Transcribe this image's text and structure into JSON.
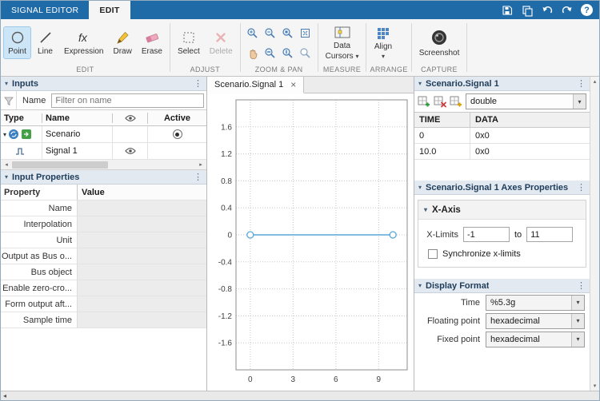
{
  "colors": {
    "accent_blue": "#1e6ba8",
    "signal_line": "#59a7d7",
    "selection": "#cde6f7"
  },
  "icons": {
    "dropdown_arrow": "▾",
    "menu_dots": "⋮",
    "collapse_arrow": "▾",
    "close": "×",
    "scroll_left": "◂",
    "scroll_right": "▸",
    "scroll_up": "▴",
    "scroll_down": "▾",
    "collapse_panel": "◂",
    "help": "?"
  },
  "topbar": {
    "tabs": [
      {
        "label": "SIGNAL EDITOR"
      },
      {
        "label": "EDIT"
      }
    ]
  },
  "ribbon": {
    "edit_section": "EDIT",
    "adjust_section": "ADJUST",
    "zoom_section": "ZOOM & PAN",
    "measure_section": "MEASURE",
    "arrange_section": "ARRANGE",
    "capture_section": "CAPTURE",
    "point": "Point",
    "line": "Line",
    "expression": "Expression",
    "draw": "Draw",
    "erase": "Erase",
    "select": "Select",
    "delete": "Delete",
    "data_cursors_line1": "Data",
    "data_cursors_line2": "Cursors",
    "align": "Align",
    "screenshot": "Screenshot"
  },
  "inputs_panel": {
    "title": "Inputs",
    "filter_label": "Name",
    "filter_placeholder": "Filter on name",
    "col_type": "Type",
    "col_name": "Name",
    "col_active": "Active",
    "rows": [
      {
        "name": "Scenario",
        "active": true,
        "visible": false
      },
      {
        "name": "Signal 1",
        "active": false,
        "visible": true
      }
    ]
  },
  "properties_panel": {
    "title": "Input Properties",
    "col_property": "Property",
    "col_value": "Value",
    "rows": [
      "Name",
      "Interpolation",
      "Unit",
      "Output as Bus o...",
      "Bus object",
      "Enable zero-cro...",
      "Form output aft...",
      "Sample time"
    ]
  },
  "canvas": {
    "tab_label": "Scenario.Signal 1"
  },
  "chart_data": {
    "type": "line",
    "title": "",
    "xlabel": "",
    "ylabel": "",
    "xlim": [
      -1,
      11
    ],
    "ylim": [
      -2,
      2
    ],
    "xticks": [
      0,
      3,
      6,
      9
    ],
    "yticks": [
      -1.6,
      -1.2,
      -0.8,
      -0.4,
      0,
      0.4,
      0.8,
      1.2,
      1.6
    ],
    "grid": true,
    "grid_style": "dotted",
    "legend": false,
    "series": [
      {
        "name": "Scenario.Signal 1",
        "x": [
          0,
          10
        ],
        "y": [
          0,
          0
        ],
        "color": "#59a7d7",
        "marker": "o"
      }
    ]
  },
  "signal_panel": {
    "title": "Scenario.Signal 1",
    "type_value": "double",
    "col_time": "TIME",
    "col_data": "DATA",
    "rows": [
      {
        "time": "0",
        "data": "0x0"
      },
      {
        "time": "10.0",
        "data": "0x0"
      }
    ]
  },
  "axes_panel": {
    "title": "Scenario.Signal 1 Axes Properties",
    "x_axis_title": "X-Axis",
    "x_limits_label": "X-Limits",
    "x_min": "-1",
    "to_label": "to",
    "x_max": "11",
    "sync_label": "Synchronize x-limits",
    "sync_checked": false
  },
  "format_panel": {
    "title": "Display Format",
    "time_label": "Time",
    "time_value": "%5.3g",
    "floating_label": "Floating point",
    "floating_value": "hexadecimal",
    "fixed_label": "Fixed point",
    "fixed_value": "hexadecimal"
  }
}
